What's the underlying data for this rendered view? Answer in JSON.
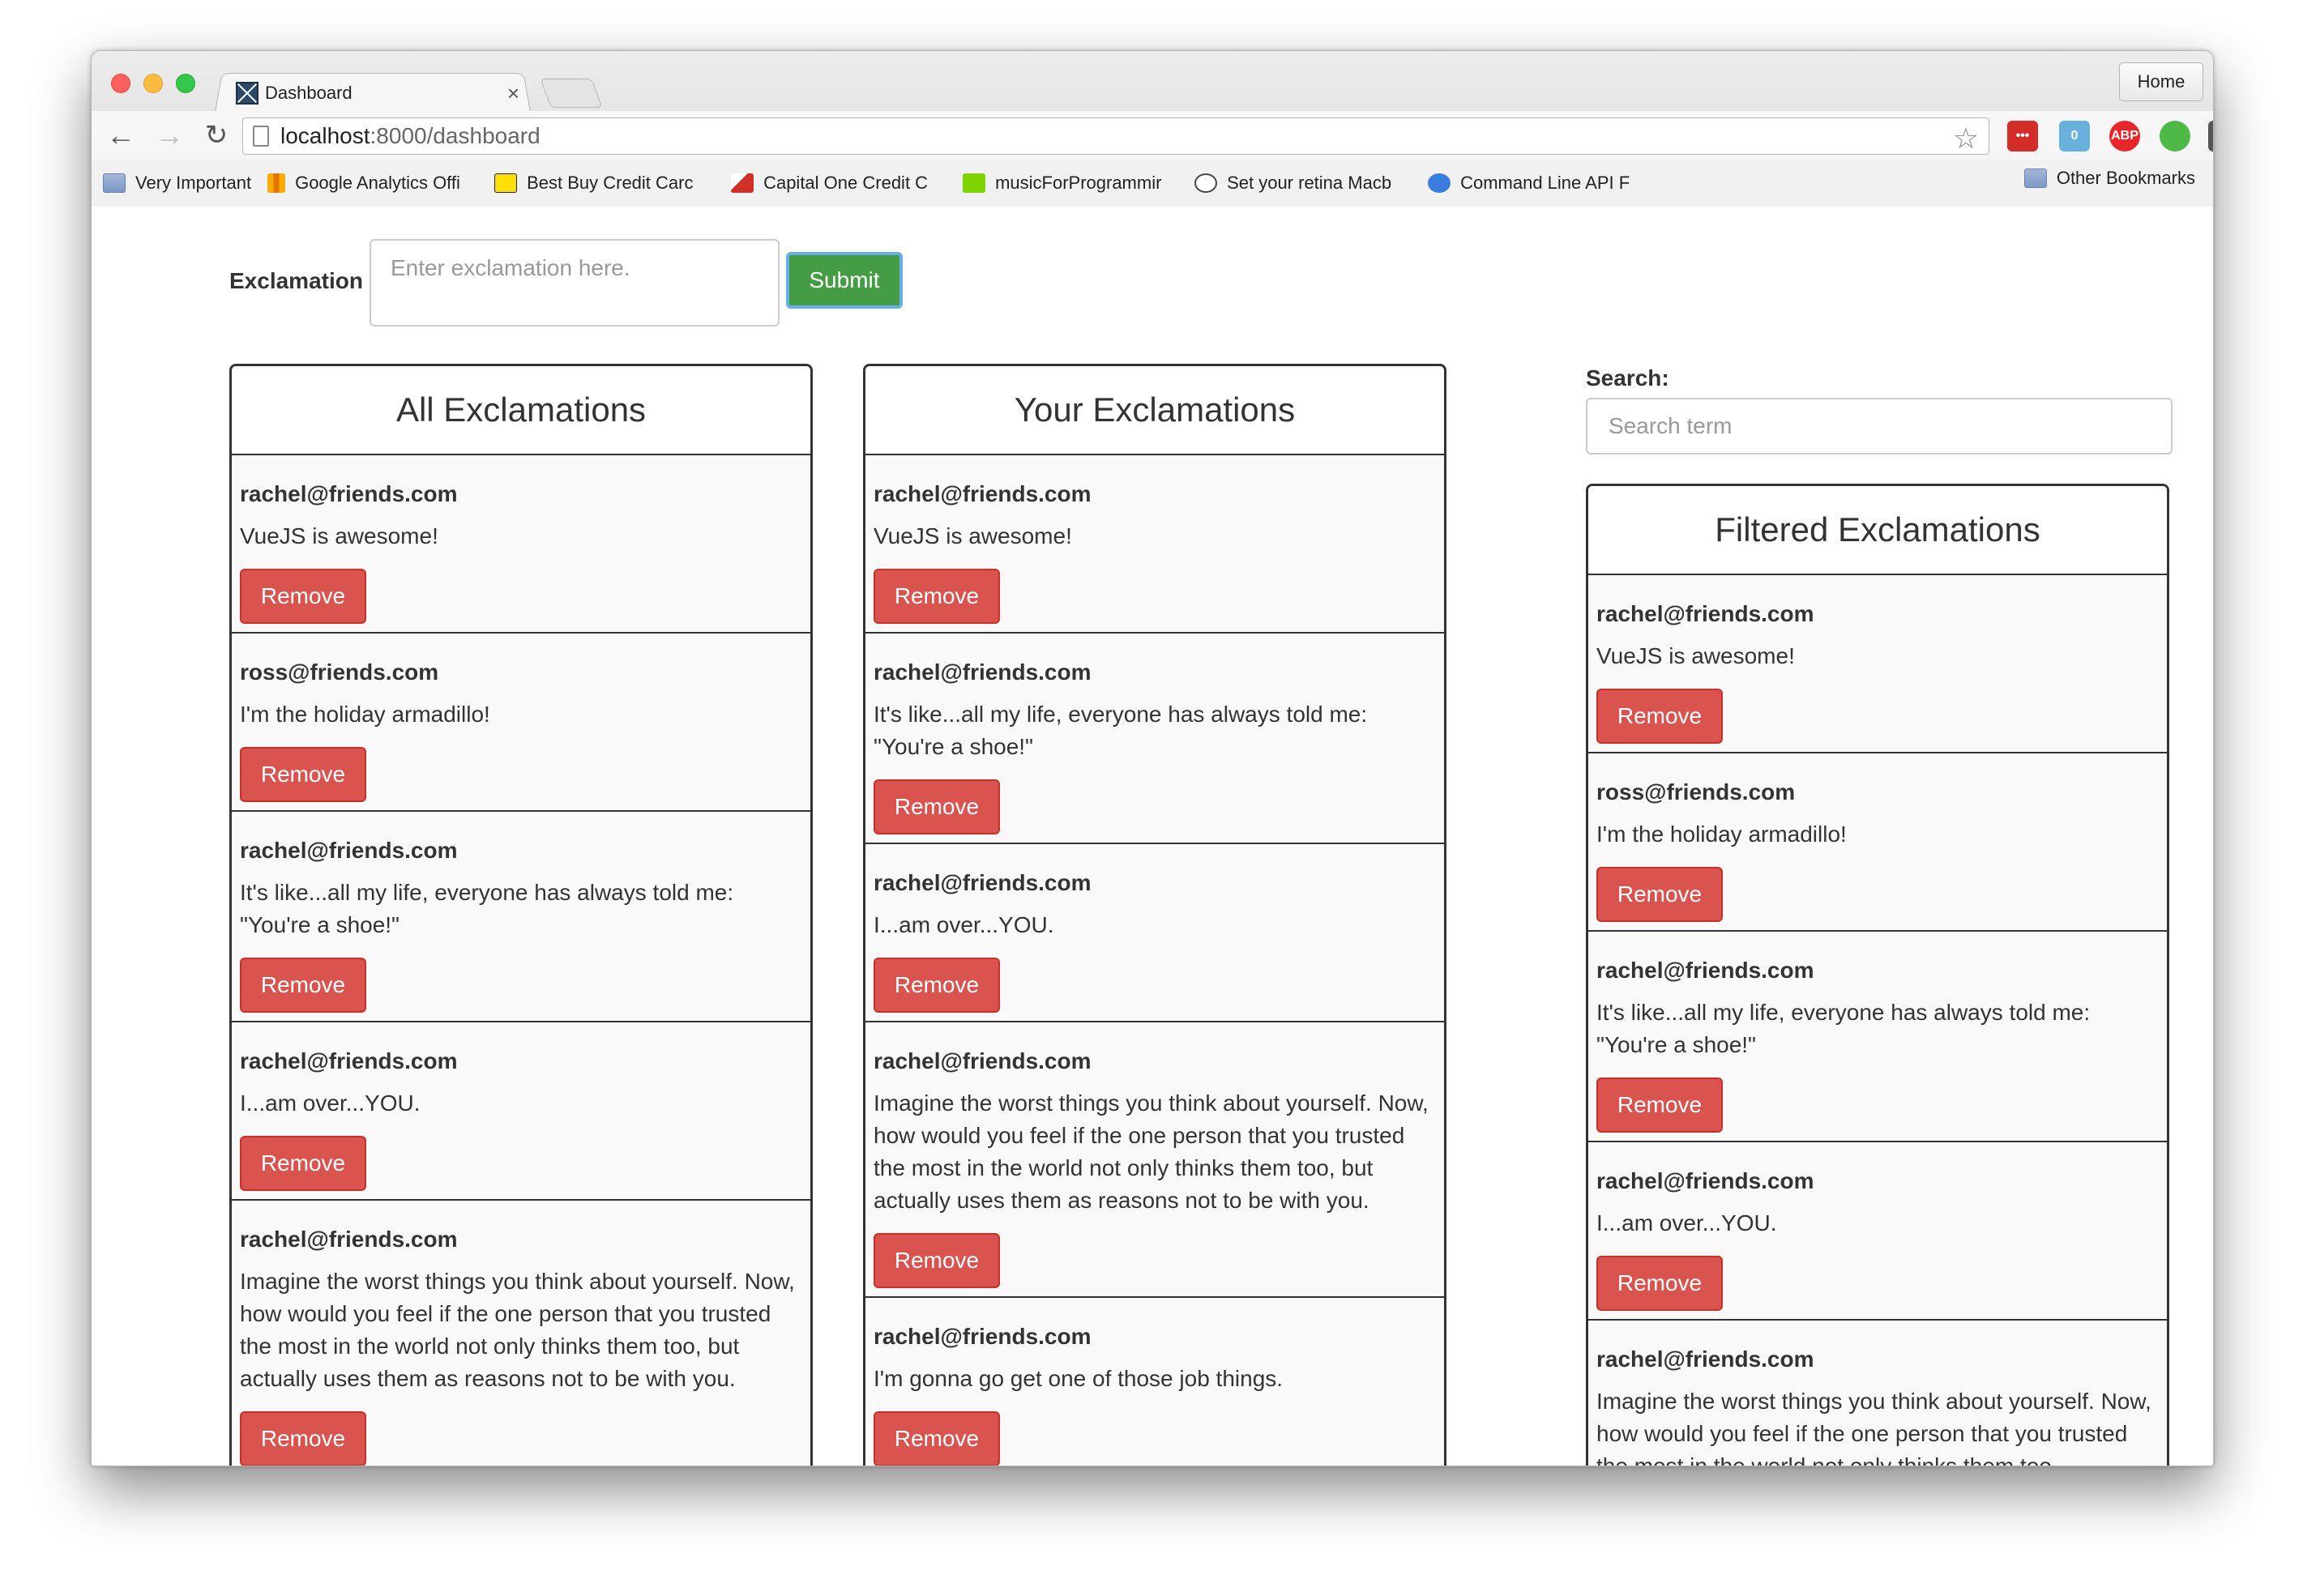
{
  "browser": {
    "tab_title": "Dashboard",
    "tab_close": "×",
    "home_label": "Home",
    "url_host": "localhost",
    "url_rest": ":8000/dashboard",
    "bookmarks": [
      {
        "label": "Very Important",
        "icon": "folder-icon"
      },
      {
        "label": "Google Analytics Offi",
        "icon": "analytics-icon"
      },
      {
        "label": "Best Buy Credit Carc",
        "icon": "bestbuy-icon"
      },
      {
        "label": "Capital One Credit C",
        "icon": "capitalone-icon"
      },
      {
        "label": "musicForProgrammir",
        "icon": "music-icon"
      },
      {
        "label": "Set your retina Macb",
        "icon": "reddit-icon"
      },
      {
        "label": "Command Line API F",
        "icon": "gear-icon"
      }
    ],
    "other_bookmarks": "Other Bookmarks",
    "extensions": [
      {
        "name": "lastpass-icon",
        "text": "•••",
        "color": "#d32d27"
      },
      {
        "name": "ghostery-icon",
        "text": "0",
        "color": "#6ab0de"
      },
      {
        "name": "adblock-icon",
        "text": "ABP",
        "color": "#e8262a"
      },
      {
        "name": "evernote-icon",
        "text": "",
        "color": "#4fb948"
      },
      {
        "name": "pocket-icon",
        "text": "",
        "color": "#555555"
      },
      {
        "name": "mail-icon",
        "text": "",
        "color": "#555555"
      },
      {
        "name": "menu-icon",
        "text": "☰",
        "color": "#555555"
      }
    ]
  },
  "form": {
    "label": "Exclamation",
    "placeholder": "Enter exclamation here.",
    "submit": "Submit"
  },
  "remove_label": "Remove",
  "all": {
    "title": "All Exclamations",
    "items": [
      {
        "email": "rachel@friends.com",
        "text": "VueJS is awesome!"
      },
      {
        "email": "ross@friends.com",
        "text": "I'm the holiday armadillo!"
      },
      {
        "email": "rachel@friends.com",
        "text": "It's like...all my life, everyone has always told me: \"You're a shoe!\""
      },
      {
        "email": "rachel@friends.com",
        "text": "I...am over...YOU."
      },
      {
        "email": "rachel@friends.com",
        "text": "Imagine the worst things you think about yourself. Now, how would you feel if the one person that you trusted the most in the world not only thinks them too, but actually uses them as reasons not to be with you."
      }
    ]
  },
  "yours": {
    "title": "Your Exclamations",
    "items": [
      {
        "email": "rachel@friends.com",
        "text": "VueJS is awesome!"
      },
      {
        "email": "rachel@friends.com",
        "text": "It's like...all my life, everyone has always told me: \"You're a shoe!\""
      },
      {
        "email": "rachel@friends.com",
        "text": "I...am over...YOU."
      },
      {
        "email": "rachel@friends.com",
        "text": "Imagine the worst things you think about yourself. Now, how would you feel if the one person that you trusted the most in the world not only thinks them too, but actually uses them as reasons not to be with you."
      },
      {
        "email": "rachel@friends.com",
        "text": "I'm gonna go get one of those job things."
      }
    ]
  },
  "search": {
    "label": "Search:",
    "placeholder": "Search term"
  },
  "filtered": {
    "title": "Filtered Exclamations",
    "items": [
      {
        "email": "ross@friends.com",
        "text": "I'm the holiday armadillo!"
      },
      {
        "email": "rachel@friends.com",
        "text": "It's like...all my life, everyone has always told me: \"You're a shoe!\""
      },
      {
        "email": "rachel@friends.com",
        "text": "I...am over...YOU."
      },
      {
        "email": "rachel@friends.com",
        "text": "Imagine the worst things you think about yourself. Now, how would you feel if the one person that you trusted the most in the world not only thinks them too,"
      }
    ],
    "first": {
      "email": "rachel@friends.com",
      "text": "VueJS is awesome!"
    }
  }
}
